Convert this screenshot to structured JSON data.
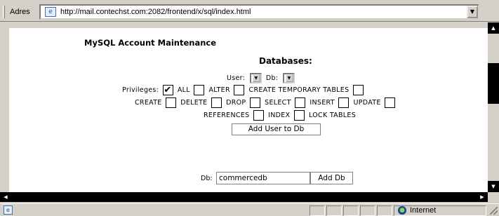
{
  "address_bar": {
    "label": "Adres",
    "url": "http://mail.contechst.com:2082/frontend/x/sql/index.html",
    "page_icon": "ie-page-icon",
    "dropdown_icon": "chevron-down-icon"
  },
  "page": {
    "title": "MySQL Account Maintenance",
    "section_heading": "Databases:",
    "user_label": "User:",
    "db_label": "Db:",
    "privileges_label": "Privileges:",
    "privileges": {
      "all": "ALL",
      "alter": "ALTER",
      "create_temporary_tables": "CREATE TEMPORARY TABLES",
      "create": "CREATE",
      "delete": "DELETE",
      "drop": "DROP",
      "select": "SELECT",
      "insert": "INSERT",
      "update": "UPDATE",
      "references": "REFERENCES",
      "index": "INDEX",
      "lock_tables": "LOCK TABLES"
    },
    "all_checked": "✔",
    "add_user_button": "Add User to Db",
    "new_db_label": "Db:",
    "new_db_value": "commercedb",
    "add_db_button": "Add Db"
  },
  "status_bar": {
    "zone_text": "Internet",
    "zone_icon": "globe-icon"
  }
}
